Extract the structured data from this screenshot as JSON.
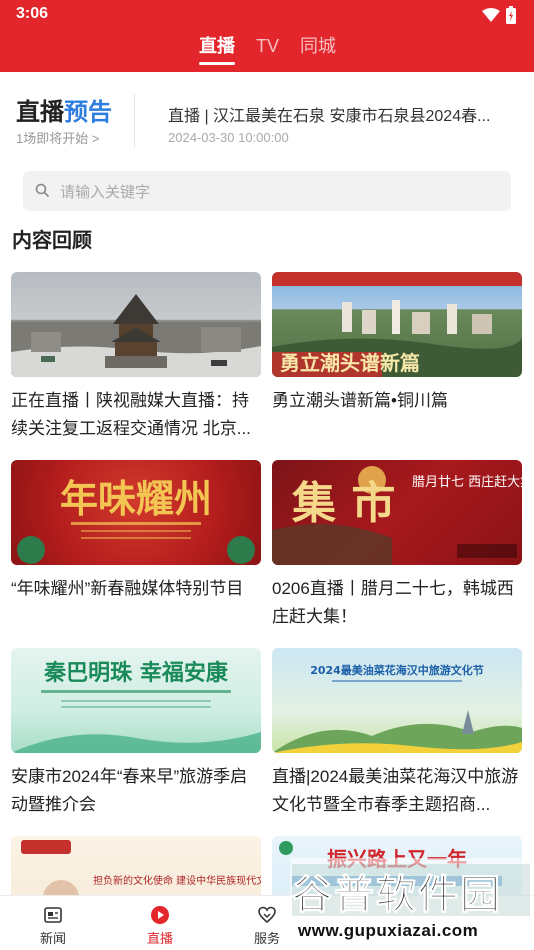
{
  "status": {
    "time": "3:06"
  },
  "tabs": [
    {
      "label": "直播",
      "active": true
    },
    {
      "label": "TV",
      "active": false
    },
    {
      "label": "同城",
      "active": false
    }
  ],
  "preview": {
    "title_main": "直播",
    "title_accent": "预告",
    "subtitle": "1场即将开始 >",
    "item_title": "直播 | 汉江最美在石泉 安康市石泉县2024春...",
    "item_time": "2024-03-30 10:00:00"
  },
  "search": {
    "placeholder": "请输入关键字"
  },
  "section_title": "内容回顾",
  "cards": [
    {
      "title": "正在直播丨陕视融媒大直播：持续关注复工返程交通情况 北京...",
      "thumb": "city-bell-tower"
    },
    {
      "title": "勇立潮头谱新篇•铜川篇",
      "thumb": "city-aerial",
      "overlay": "勇立潮头谱新篇"
    },
    {
      "title": "“年味耀州”新春融媒体特别节目",
      "thumb": "new-year-show",
      "overlay": "年味耀州"
    },
    {
      "title": "0206直播丨腊月二十七，韩城西庄赶大集！",
      "thumb": "market-fair",
      "overlay": "腊月廿七 西庄赶大集",
      "overlay2": "集 市"
    },
    {
      "title": "安康市2024年“春来早”旅游季启动暨推介会",
      "thumb": "tourism-launch",
      "overlay": "秦巴明珠 幸福安康"
    },
    {
      "title": "直播|2024最美油菜花海汉中旅游文化节暨全市春季主题招商...",
      "thumb": "rapeseed-festival",
      "overlay": "2024最美油菜花海汉中旅游文化节"
    },
    {
      "title": "",
      "thumb": "culture-lecture",
      "overlay": "担负新的文化使命 建设中华民族现代文明"
    },
    {
      "title": "",
      "thumb": "rural-revival",
      "overlay": "振兴路上又一年"
    }
  ],
  "bottom_nav": [
    {
      "label": "新闻",
      "icon": "news-icon",
      "active": false
    },
    {
      "label": "直播",
      "icon": "live-play-icon",
      "active": true
    },
    {
      "label": "服务",
      "icon": "service-heart-icon",
      "active": false
    }
  ],
  "watermark": {
    "main": "谷普软件园",
    "url": "www.gupuxiazai.com"
  },
  "colors": {
    "brand_red": "#e3262b",
    "accent_blue": "#2f7de1"
  }
}
